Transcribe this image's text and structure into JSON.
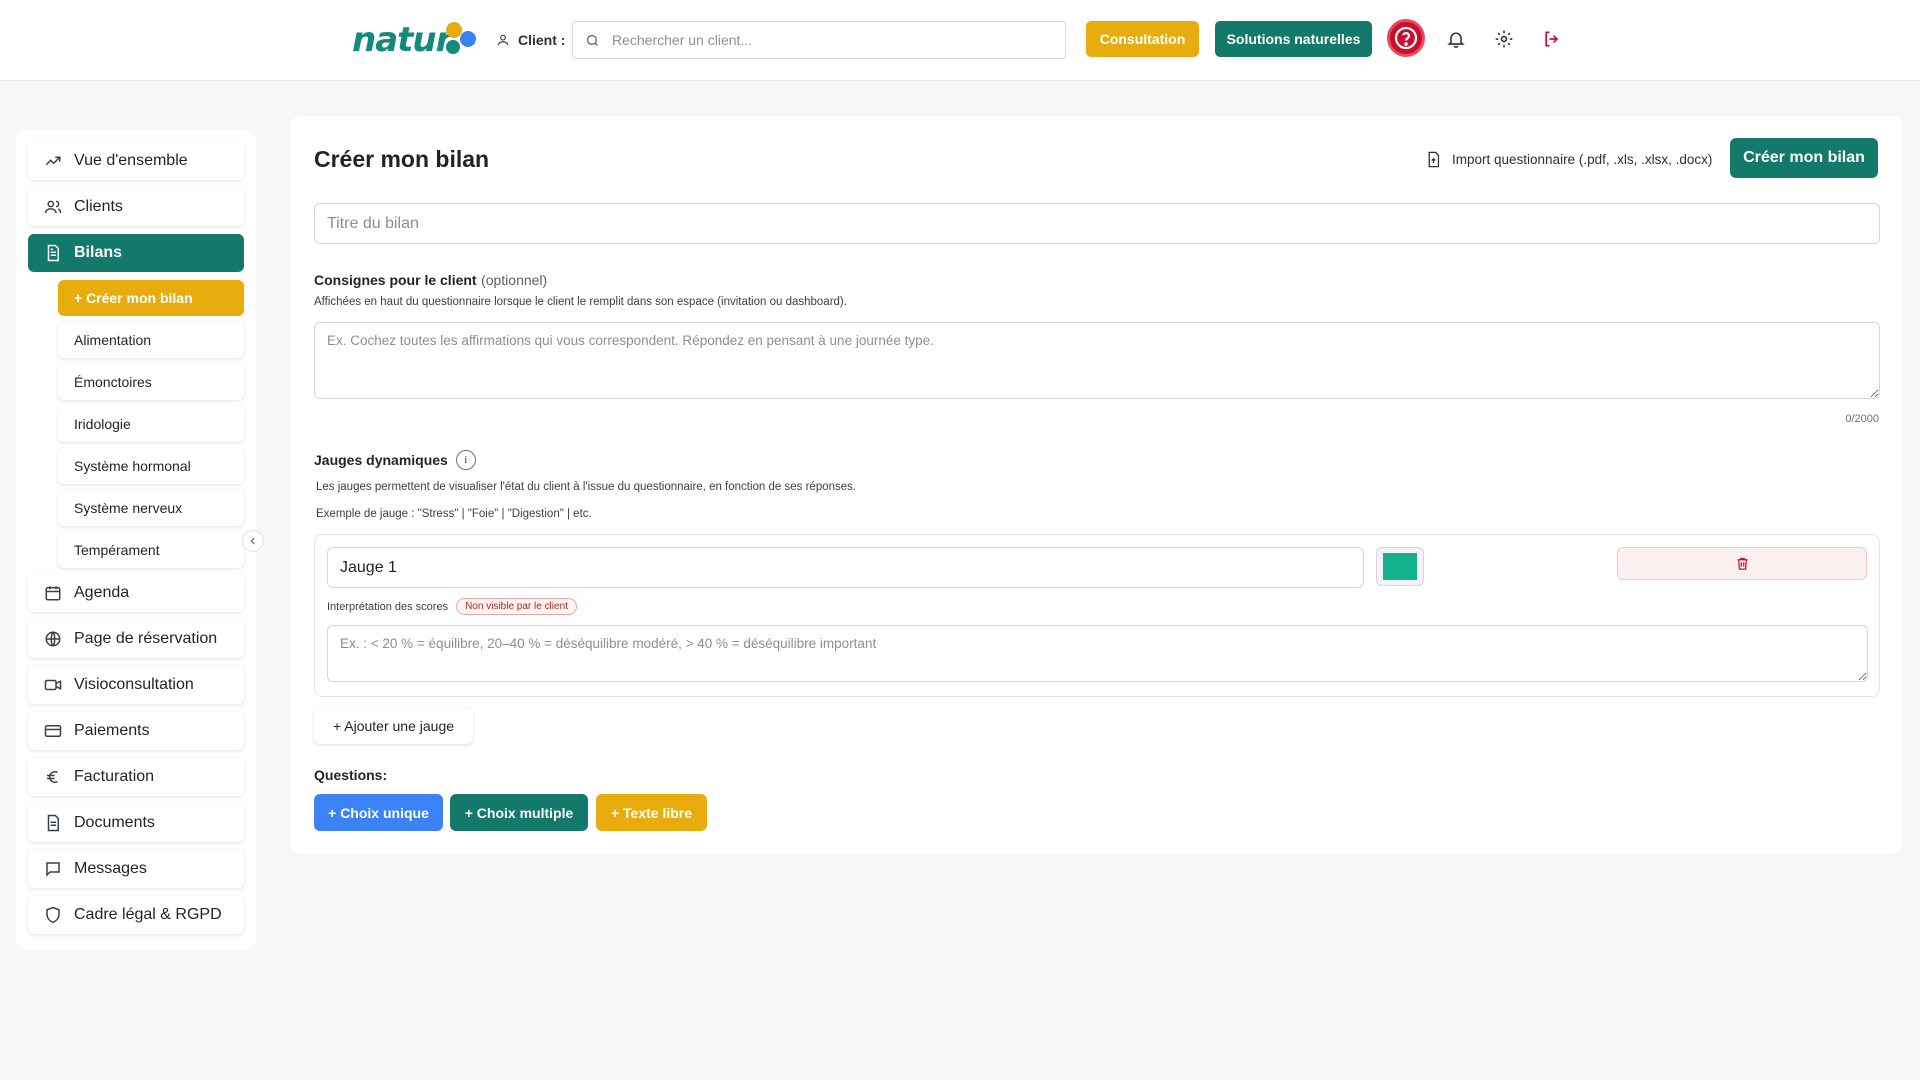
{
  "header": {
    "logo_text": "natur",
    "client_label": "Client :",
    "search_placeholder": "Rechercher un client...",
    "consultation_label": "Consultation",
    "solutions_label": "Solutions naturelles"
  },
  "colors": {
    "brand_green": "#12796b",
    "brand_yellow": "#e8ac0e",
    "action_blue": "#3b82f6",
    "help_red": "#c8102e",
    "gauge_color": "#13b08a"
  },
  "sidebar": {
    "items": [
      {
        "label": "Vue d'ensemble",
        "icon": "trend-up-icon"
      },
      {
        "label": "Clients",
        "icon": "users-icon"
      },
      {
        "label": "Bilans",
        "icon": "document-icon"
      },
      {
        "label": "Agenda",
        "icon": "calendar-icon"
      },
      {
        "label": "Page de réservation",
        "icon": "globe-icon"
      },
      {
        "label": "Visioconsultation",
        "icon": "video-icon"
      },
      {
        "label": "Paiements",
        "icon": "credit-card-icon"
      },
      {
        "label": "Facturation",
        "icon": "euro-icon"
      },
      {
        "label": "Documents",
        "icon": "file-icon"
      },
      {
        "label": "Messages",
        "icon": "message-icon"
      },
      {
        "label": "Cadre légal & RGPD",
        "icon": "shield-icon"
      }
    ],
    "sub_items": [
      {
        "label": "+ Créer mon bilan"
      },
      {
        "label": "Alimentation"
      },
      {
        "label": "Émonctoires"
      },
      {
        "label": "Iridologie"
      },
      {
        "label": "Système hormonal"
      },
      {
        "label": "Système nerveux"
      },
      {
        "label": "Tempérament"
      }
    ]
  },
  "main": {
    "title": "Créer mon bilan",
    "import_label": "Import questionnaire (.pdf, .xls, .xlsx, .docx)",
    "create_button": "Créer mon bilan",
    "title_placeholder": "Titre du bilan",
    "instructions": {
      "label": "Consignes pour le client",
      "optional": "(optionnel)",
      "hint": "Affichées en haut du questionnaire lorsque le client le remplit dans son espace (invitation ou dashboard).",
      "placeholder": "Ex. Cochez toutes les affirmations qui vous correspondent. Répondez en pensant à une journée type.",
      "counter": "0/2000"
    },
    "gauges": {
      "label": "Jauges dynamiques",
      "info_glyph": "i",
      "hint1": "Les jauges permettent de visualiser l'état du client à l'issue du questionnaire, en fonction de ses réponses.",
      "hint2": "Exemple de jauge : \"Stress\" | \"Foie\" | \"Digestion\" | etc.",
      "items": [
        {
          "name": "Jauge 1",
          "score_label": "Interprétation des scores",
          "badge": "Non visible par le client",
          "placeholder": "Ex. : < 20 % = équilibre, 20–40 % = déséquilibre modéré, > 40 % = déséquilibre important"
        }
      ],
      "add_button": "+ Ajouter une jauge"
    },
    "questions": {
      "label": "Questions:",
      "single_choice": "+ Choix unique",
      "multiple_choice": "+ Choix multiple",
      "free_text": "+ Texte libre"
    }
  }
}
